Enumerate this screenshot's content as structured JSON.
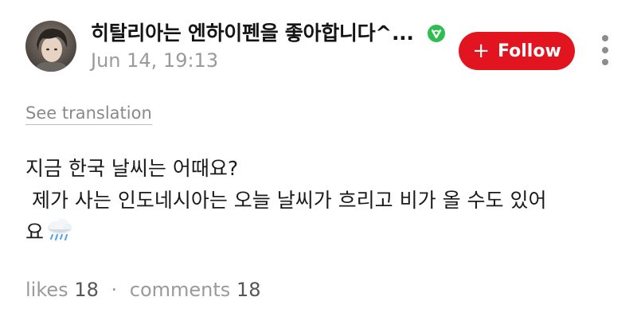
{
  "post": {
    "author": {
      "name": "히탈리아는 엔하이펜을 좋아합니다^...",
      "verified": true
    },
    "date": "Jun 14, 19:13",
    "follow_label": "Follow",
    "follow_icon": "+",
    "see_translation": "See translation",
    "body_lines": [
      "지금 한국 날씨는 어때요?",
      " 제가 사는 인도네시아는 오늘 날씨가 흐리고 비가 올 수도 있어",
      "요"
    ],
    "body_emoji": "cloud-with-rain-icon",
    "stats": {
      "likes_label": "likes",
      "likes_count": "18",
      "separator": "·",
      "comments_label": "comments",
      "comments_count": "18"
    }
  },
  "colors": {
    "follow_button": "#e1141f",
    "verified_badge": "#2ebd4f",
    "muted_text": "#9a9a9a"
  }
}
